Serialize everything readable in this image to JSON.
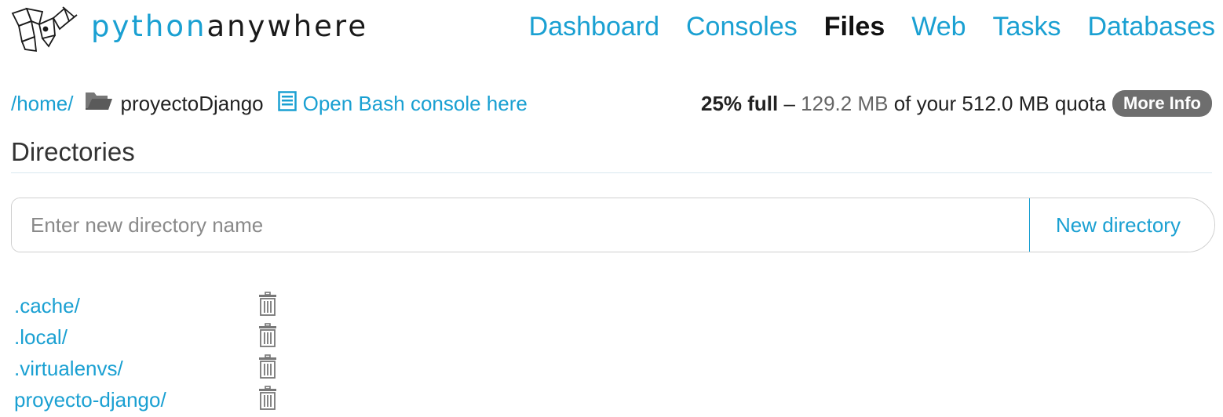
{
  "header": {
    "brand_part1": "python",
    "brand_part2": "anywhere",
    "logo_icon": "pythonanywhere-logo-icon",
    "nav": [
      {
        "label": "Dashboard",
        "active": false
      },
      {
        "label": "Consoles",
        "active": false
      },
      {
        "label": "Files",
        "active": true
      },
      {
        "label": "Web",
        "active": false
      },
      {
        "label": "Tasks",
        "active": false
      },
      {
        "label": "Databases",
        "active": false
      }
    ]
  },
  "breadcrumb": {
    "home": "/home/",
    "folder_icon": "folder-icon",
    "current": "proyectoDjango",
    "bash_icon": "document-list-icon",
    "bash_label": "Open Bash console here"
  },
  "quota": {
    "percent": "25% full",
    "dash": " – ",
    "used": "129.2 MB",
    "of_text": " of your ",
    "total": "512.0 MB",
    "quota_text": " quota",
    "more_info": "More Info"
  },
  "directories": {
    "title": "Directories",
    "input_placeholder": "Enter new directory name",
    "new_button": "New directory",
    "items": [
      {
        "name": ".cache/"
      },
      {
        "name": ".local/"
      },
      {
        "name": ".virtualenvs/"
      },
      {
        "name": "proyecto-django/"
      }
    ]
  },
  "colors": {
    "accent": "#1aa0d2",
    "badge": "#6e6e6e"
  }
}
